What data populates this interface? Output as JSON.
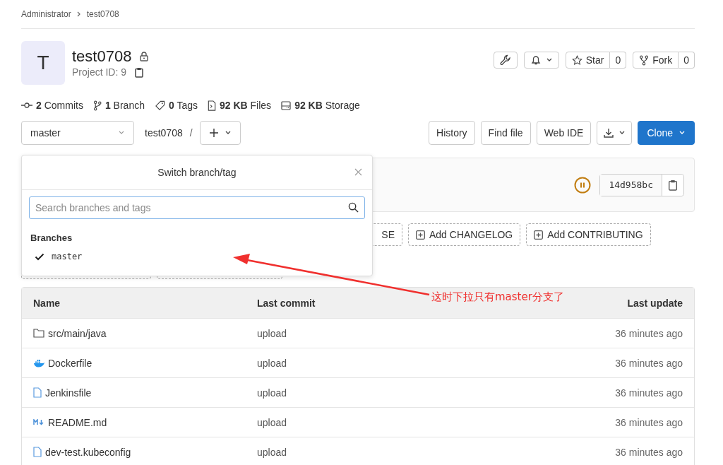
{
  "breadcrumb": [
    "Administrator",
    "test0708"
  ],
  "project": {
    "avatar_letter": "T",
    "name": "test0708",
    "project_id": "Project ID: 9"
  },
  "header_buttons": {
    "star": {
      "label": "Star",
      "count": "0"
    },
    "fork": {
      "label": "Fork",
      "count": "0"
    }
  },
  "stats": [
    {
      "kind": "commits",
      "text": "**2** Commits"
    },
    {
      "kind": "branch",
      "text": "**1** Branch"
    },
    {
      "kind": "tags",
      "text": "**0** Tags"
    },
    {
      "kind": "files",
      "text": "**92 KB** Files"
    },
    {
      "kind": "storage",
      "text": "**92 KB** Storage"
    }
  ],
  "toolbar": {
    "branch": "master",
    "path": "test0708",
    "path_separator": "/",
    "buttons": [
      "History",
      "Find file",
      "Web IDE"
    ],
    "clone": "Clone"
  },
  "commit": {
    "sha": "14d958bc"
  },
  "add_buttons": [
    {
      "label": "SE"
    },
    {
      "label": "Add CHANGELOG"
    },
    {
      "label": "Add CONTRIBUTING"
    }
  ],
  "branch_dropdown": {
    "title": "Switch branch/tag",
    "search": {
      "placeholder": "Search branches and tags"
    },
    "section": "Branches",
    "items": [
      {
        "name": "master",
        "selected": true
      }
    ]
  },
  "table": {
    "columns": [
      "Name",
      "Last commit",
      "Last update"
    ],
    "rows": [
      {
        "name": "src/main/java",
        "kind": "folder",
        "commit": "upload",
        "updated": "36 minutes ago"
      },
      {
        "name": "Dockerfile",
        "kind": "docker",
        "commit": "upload",
        "updated": "36 minutes ago"
      },
      {
        "name": "Jenkinsfile",
        "kind": "file",
        "commit": "upload",
        "updated": "36 minutes ago"
      },
      {
        "name": "README.md",
        "kind": "markdown",
        "commit": "upload",
        "updated": "36 minutes ago"
      },
      {
        "name": "dev-test.kubeconfig",
        "kind": "file",
        "commit": "upload",
        "updated": "36 minutes ago"
      }
    ]
  },
  "annotation": {
    "text": "这时下拉只有master分支了"
  }
}
